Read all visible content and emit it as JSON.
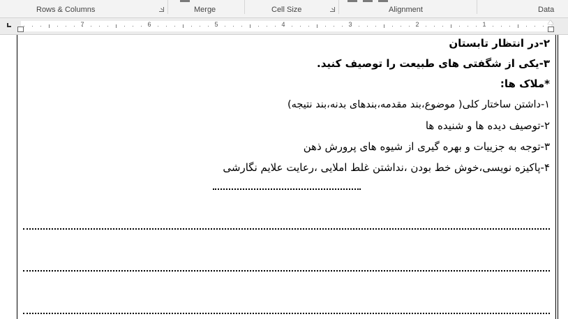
{
  "ribbon": {
    "groups": [
      {
        "label": "Rows & Columns"
      },
      {
        "label": "Merge"
      },
      {
        "label": "Cell Size"
      },
      {
        "label": "Alignment"
      },
      {
        "label": "Data"
      }
    ]
  },
  "ruler": {
    "labels": [
      "7",
      "6",
      "5",
      "4",
      "3",
      "2",
      "1"
    ]
  },
  "document": {
    "lines": [
      "۲-در انتظار تابستان",
      "۳-یکی از شگفتی های طبیعت را توصیف کنید.",
      "*ملاک ها:",
      "۱-داشتن ساختار کلی( موضوع،بند مقدمه،بندهای بدنه،بند نتیجه)",
      "۲-توصیف دیده ها و شنیده ها",
      "۳-توجه به جزییات و بهره گیری از شیوه های پرورش ذهن",
      "۴-پاکیزه نویسی،خوش خط بودن ،نداشتن غلط املایی ،رعایت علایم نگارشی"
    ]
  }
}
